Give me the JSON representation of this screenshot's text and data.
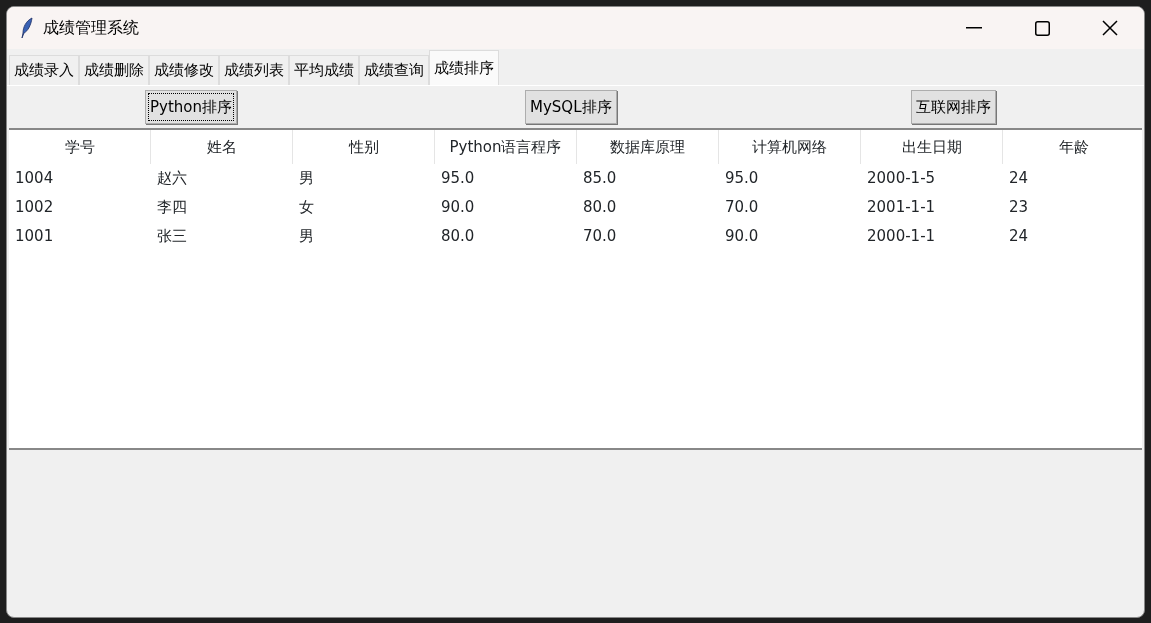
{
  "window": {
    "title": "成绩管理系统"
  },
  "tabs": [
    {
      "label": "成绩录入",
      "selected": false
    },
    {
      "label": "成绩删除",
      "selected": false
    },
    {
      "label": "成绩修改",
      "selected": false
    },
    {
      "label": "成绩列表",
      "selected": false
    },
    {
      "label": "平均成绩",
      "selected": false
    },
    {
      "label": "成绩查询",
      "selected": false
    },
    {
      "label": "成绩排序",
      "selected": true
    }
  ],
  "buttons": [
    {
      "label": "Python排序",
      "focused": true
    },
    {
      "label": "MySQL排序",
      "focused": false
    },
    {
      "label": "互联网排序",
      "focused": false
    }
  ],
  "table": {
    "columns": [
      "学号",
      "姓名",
      "性别",
      "Python语言程序",
      "数据库原理",
      "计算机网络",
      "出生日期",
      "年龄"
    ],
    "rows": [
      [
        "1004",
        "赵六",
        "男",
        "95.0",
        "85.0",
        "95.0",
        "2000-1-5",
        "24"
      ],
      [
        "1002",
        "李四",
        "女",
        "90.0",
        "80.0",
        "70.0",
        "2001-1-1",
        "23"
      ],
      [
        "1001",
        "张三",
        "男",
        "80.0",
        "70.0",
        "90.0",
        "2000-1-1",
        "24"
      ]
    ]
  }
}
